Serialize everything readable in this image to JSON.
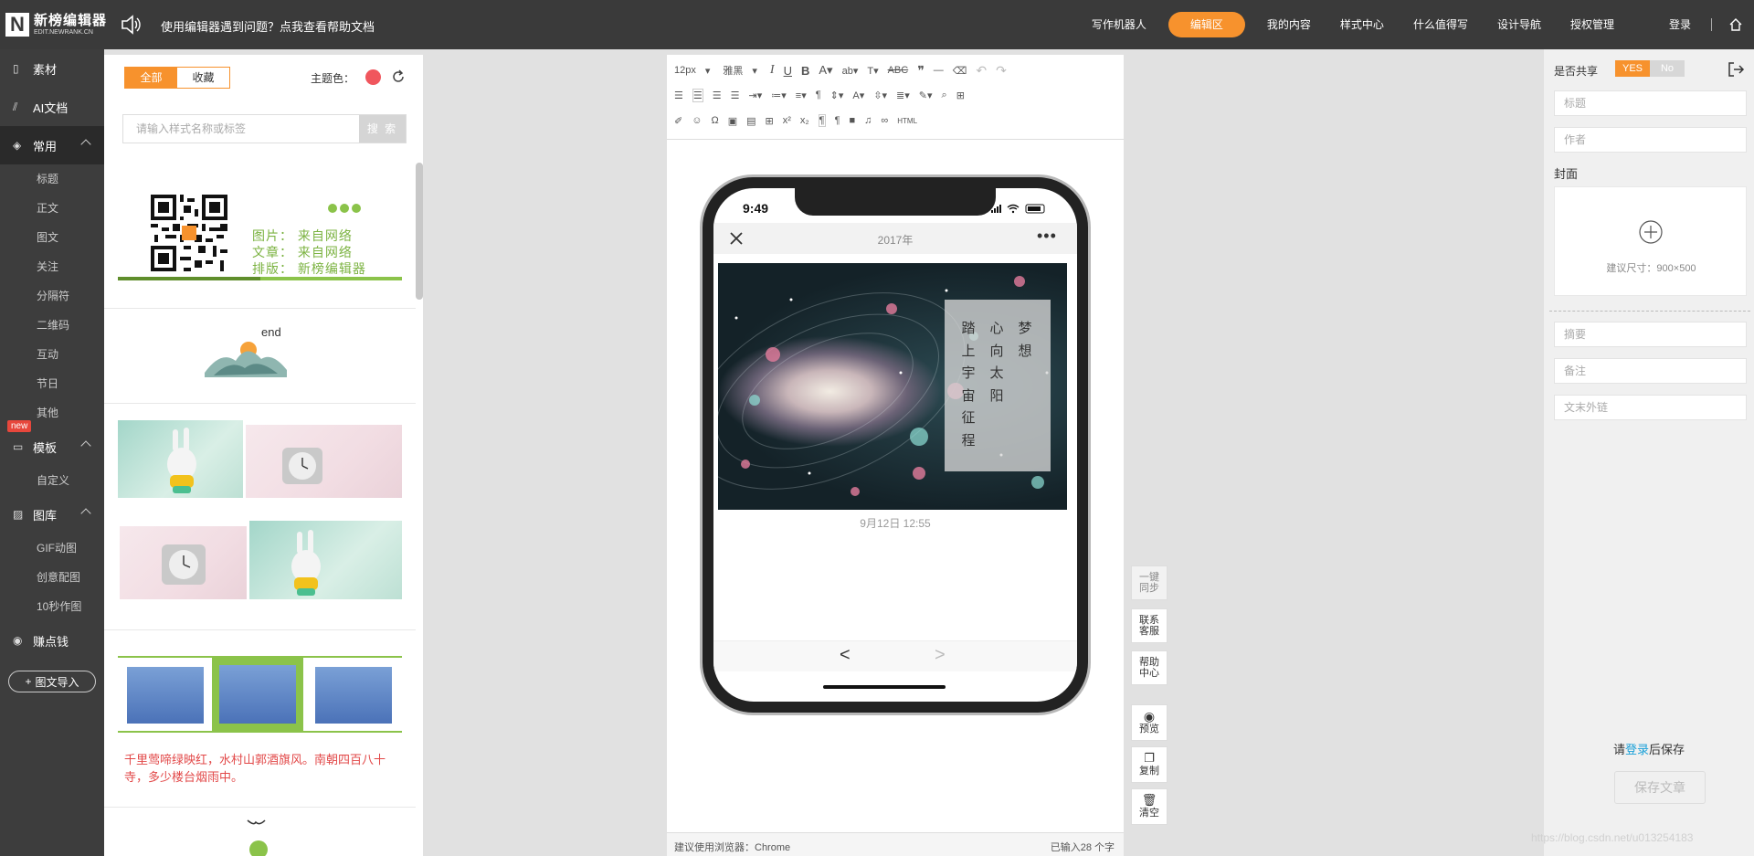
{
  "topbar": {
    "logo_mark": "N",
    "logo_name": "新榜编辑器",
    "logo_sub": "EDIT.NEWRANK.CN",
    "help_tip": "使用编辑器遇到问题？点我查看帮助文档",
    "nav": [
      "写作机器人",
      "编辑区",
      "我的内容",
      "样式中心",
      "什么值得写",
      "设计导航",
      "授权管理"
    ],
    "nav_active": "编辑区",
    "login": "登录"
  },
  "sidebar": {
    "material": "素材",
    "ai_doc": "AI文档",
    "common": "常用",
    "common_items": [
      "标题",
      "正文",
      "图文",
      "关注",
      "分隔符",
      "二维码",
      "互动",
      "节日",
      "其他"
    ],
    "new_badge": "new",
    "template": "模板",
    "template_items": [
      "自定义"
    ],
    "gallery": "图库",
    "gallery_items": [
      "GIF动图",
      "创意配图",
      "10秒作图"
    ],
    "earn": "赚点钱",
    "import": "图文导入"
  },
  "style_panel": {
    "tab_all": "全部",
    "tab_fav": "收藏",
    "theme_label": "主题色：",
    "theme_color": "#f0565d",
    "search_placeholder": "请输入样式名称或标签",
    "search_button": "搜 索",
    "credits": [
      "图片： 来自网络",
      "文章： 来自网络",
      "排版： 新榜编辑器"
    ],
    "end_text": "end",
    "poem": "千里莺啼绿映红，水村山郭酒旗风。南朝四百八十寺，多少楼台烟雨中。"
  },
  "editor": {
    "font_size": "12px",
    "font_family": "雅黑",
    "html_label": "HTML",
    "footer_left": "建议使用浏览器：Chrome",
    "footer_right": "已输入28 个字"
  },
  "phone": {
    "time": "9:49",
    "title": "2017年",
    "more": "•••",
    "poem_cols": [
      "梦想",
      "心向太阳",
      "踏上宇宙征程"
    ],
    "date": "9月12日 12:55",
    "prev": "<",
    "next": ">"
  },
  "float_buttons": {
    "sync": "一键同步",
    "support": "联系客服",
    "help": "帮助中心",
    "preview": "预览",
    "copy": "复制",
    "clear": "清空"
  },
  "right_panel": {
    "share_label": "是否共享",
    "yes": "YES",
    "no": "No",
    "title_placeholder": "标题",
    "author_placeholder": "作者",
    "cover_label": "封面",
    "cover_hint": "建议尺寸：900×500",
    "summary_placeholder": "摘要",
    "note_placeholder": "备注",
    "link_placeholder": "文末外链",
    "login_tip_prefix": "请",
    "login_tip_link": "登录",
    "login_tip_suffix": "后保存",
    "save_button": "保存文章"
  },
  "watermark": "https://blog.csdn.net/u013254183"
}
